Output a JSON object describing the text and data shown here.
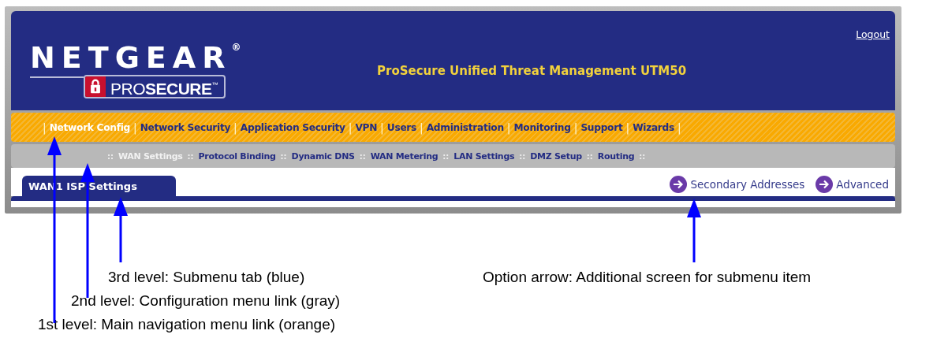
{
  "header": {
    "brand": "NETGEAR$^{®}$",
    "sub_brand": "PRO**SECURE**$^{™}$",
    "title": "ProSecure Unified Threat Management UTM50",
    "logout": "Logout"
  },
  "main_menu": [
    {
      "label": "Network Config",
      "selected": true
    },
    {
      "label": "Network Security",
      "selected": false
    },
    {
      "label": "Application Security",
      "selected": false
    },
    {
      "label": "VPN",
      "selected": false
    },
    {
      "label": "Users",
      "selected": false
    },
    {
      "label": "Administration",
      "selected": false
    },
    {
      "label": "Monitoring",
      "selected": false
    },
    {
      "label": "Support",
      "selected": false
    },
    {
      "label": "Wizards",
      "selected": false
    }
  ],
  "main_menu_separators": [
    "|",
    "|",
    "|",
    "|",
    "|",
    "|",
    "|",
    "|",
    "|",
    "|"
  ],
  "config_menu": [
    {
      "label": "WAN Settings",
      "selected": true
    },
    {
      "label": "Protocol Binding",
      "selected": false
    },
    {
      "label": "Dynamic DNS",
      "selected": false
    },
    {
      "label": "WAN Metering",
      "selected": false
    },
    {
      "label": "LAN Settings",
      "selected": false
    },
    {
      "label": "DMZ Setup",
      "selected": false
    },
    {
      "label": "Routing",
      "selected": false
    }
  ],
  "config_menu_separators": [
    "::",
    "::",
    "::",
    "::",
    "::",
    "::",
    "::",
    "::"
  ],
  "tabs": [
    {
      "label": "WAN1 ISP Settings",
      "selected": true
    }
  ],
  "option_links": [
    "Secondary Addresses",
    "Advanced"
  ],
  "callouts": [
    {
      "text": "3rd level: Submenu tab (blue)"
    },
    {
      "text": "2nd level: Configuration menu link (gray)"
    },
    {
      "text": "1st level: Main navigation menu link (orange)"
    },
    {
      "text": "Option arrow: Additional screen for submenu item"
    }
  ]
}
